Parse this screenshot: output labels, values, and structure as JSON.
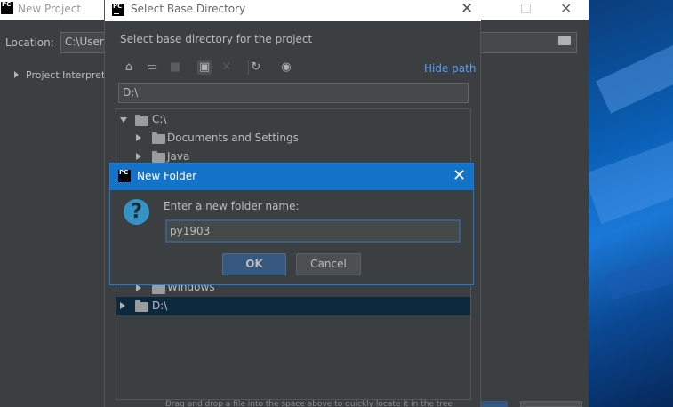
{
  "new_project": {
    "title": "New Project",
    "location_label": "Location:",
    "location_value": "C:\\Users",
    "interpreter_label": "Project Interprete"
  },
  "select_base_directory": {
    "title": "Select Base Directory",
    "description": "Select base directory for the project",
    "toolbar": {
      "icons": [
        "home-icon",
        "desktop-icon",
        "project-icon",
        "new-folder-icon",
        "delete-icon",
        "refresh-icon",
        "show-hidden-icon"
      ]
    },
    "hide_path_label": "Hide path",
    "path_value": "D:\\",
    "tree": [
      {
        "label": "C:\\",
        "expanded": true,
        "level": 0
      },
      {
        "label": "Documents and Settings",
        "expanded": false,
        "level": 1
      },
      {
        "label": "Java",
        "expanded": false,
        "level": 1
      },
      {
        "label": "Windows",
        "expanded": false,
        "level": 1
      },
      {
        "label": "D:\\",
        "expanded": false,
        "level": 0,
        "selected": true
      }
    ],
    "footer_hint": "Drag and drop a file into the space above to quickly locate it in the tree"
  },
  "new_folder_dialog": {
    "title": "New Folder",
    "prompt": "Enter a new folder name:",
    "input_value": "py1903",
    "ok_label": "OK",
    "cancel_label": "Cancel"
  },
  "logo_text": "PC",
  "colors": {
    "background": "#3c3f41",
    "accent_blue": "#1473c8",
    "link": "#589df6",
    "selection": "#0d293e"
  }
}
